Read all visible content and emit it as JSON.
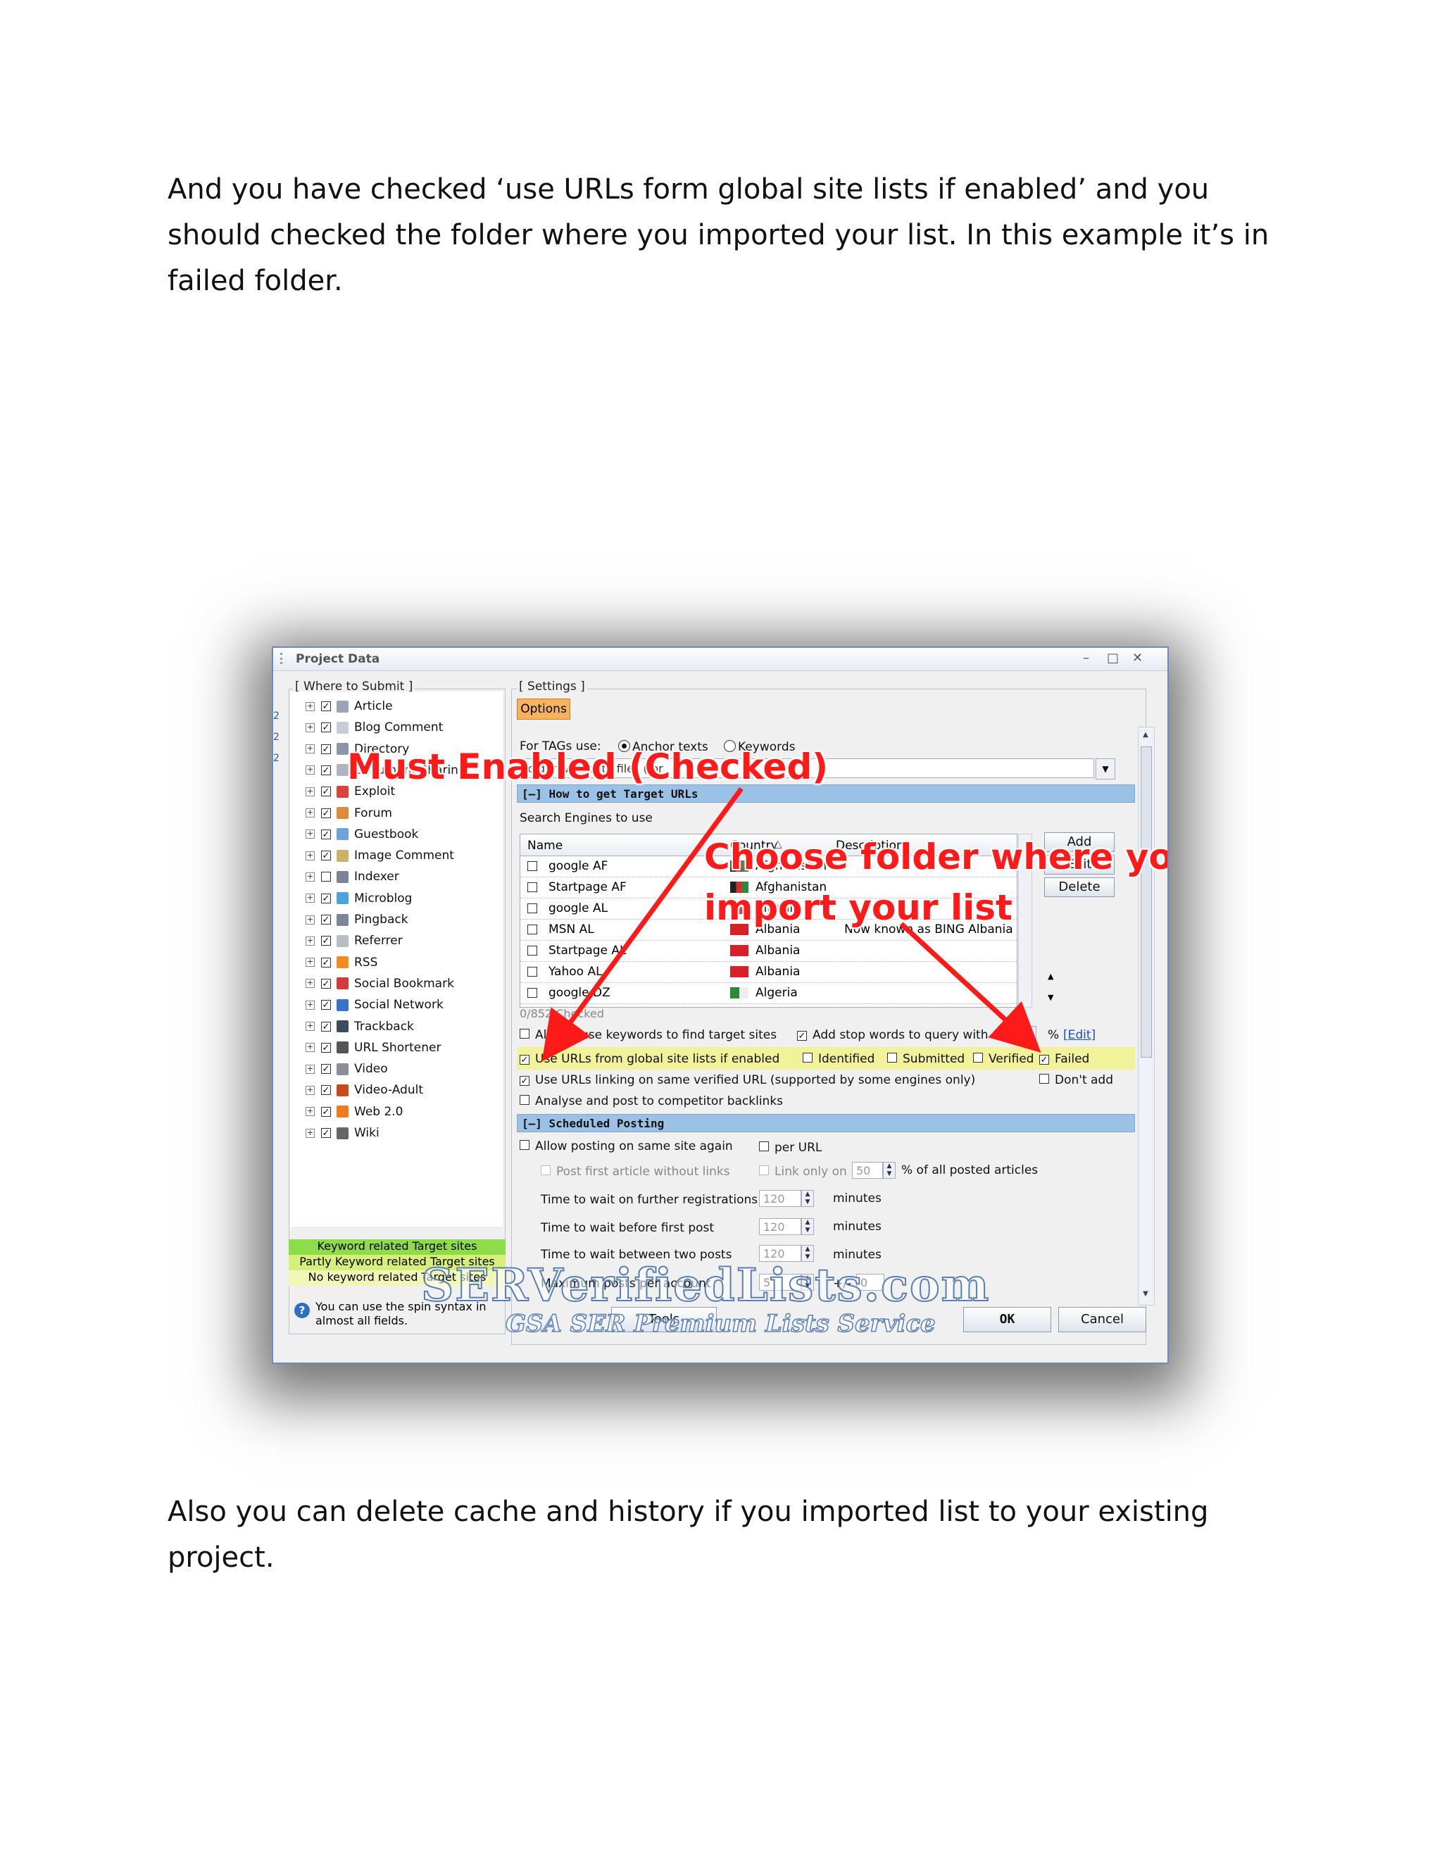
{
  "document": {
    "paragraph_1": "And you have checked ‘use URLs form global site lists if enabled’  and you should checked the folder where you imported your list. In this example it’s in failed folder.",
    "paragraph_2": "Also you can delete cache and history if you imported list to your existing project."
  },
  "window": {
    "title": "Project Data",
    "minimize": "–",
    "maximize": "□",
    "close": "✕"
  },
  "where_to_submit": {
    "legend": "[ Where to Submit ]",
    "items": [
      {
        "label": "Article",
        "checked": true,
        "icon": "article-icon",
        "color": "#9aa6b8"
      },
      {
        "label": "Blog Comment",
        "checked": true,
        "icon": "comment-icon",
        "color": "#c8ccd6"
      },
      {
        "label": "Directory",
        "checked": true,
        "icon": "directory-icon",
        "color": "#8c96aa"
      },
      {
        "label": "Document Sharing",
        "checked": true,
        "icon": "document-icon",
        "color": "#b0b4c0"
      },
      {
        "label": "Exploit",
        "checked": true,
        "icon": "exploit-icon",
        "color": "#d9443a"
      },
      {
        "label": "Forum",
        "checked": true,
        "icon": "forum-icon",
        "color": "#e08a3c"
      },
      {
        "label": "Guestbook",
        "checked": true,
        "icon": "guestbook-icon",
        "color": "#6fa4d8"
      },
      {
        "label": "Image Comment",
        "checked": true,
        "icon": "image-comment-icon",
        "color": "#c9b36a"
      },
      {
        "label": "Indexer",
        "checked": false,
        "icon": "indexer-icon",
        "color": "#7a8496"
      },
      {
        "label": "Microblog",
        "checked": true,
        "icon": "microblog-icon",
        "color": "#4aa3df"
      },
      {
        "label": "Pingback",
        "checked": true,
        "icon": "pingback-icon",
        "color": "#7b8799"
      },
      {
        "label": "Referrer",
        "checked": true,
        "icon": "referrer-icon",
        "color": "#b7bcc6"
      },
      {
        "label": "RSS",
        "checked": true,
        "icon": "rss-icon",
        "color": "#f28c1f"
      },
      {
        "label": "Social Bookmark",
        "checked": true,
        "icon": "social-bookmark-icon",
        "color": "#d63a3a"
      },
      {
        "label": "Social Network",
        "checked": true,
        "icon": "social-network-icon",
        "color": "#3a72c8"
      },
      {
        "label": "Trackback",
        "checked": true,
        "icon": "trackback-icon",
        "color": "#3e4c60"
      },
      {
        "label": "URL Shortener",
        "checked": true,
        "icon": "url-shortener-icon",
        "color": "#555"
      },
      {
        "label": "Video",
        "checked": true,
        "icon": "video-icon",
        "color": "#8a8f99"
      },
      {
        "label": "Video-Adult",
        "checked": true,
        "icon": "video-adult-icon",
        "color": "#c84a1c"
      },
      {
        "label": "Web 2.0",
        "checked": true,
        "icon": "web20-icon",
        "color": "#f07a20"
      },
      {
        "label": "Wiki",
        "checked": true,
        "icon": "wiki-icon",
        "color": "#666"
      }
    ],
    "legend_keyword_related": "Keyword related Target sites",
    "legend_partly_keyword": "Partly Keyword related Target sites",
    "legend_no_keyword": "No keyword related Target sites",
    "spin_hint": "You can use the spin syntax in almost all fields.",
    "colors": {
      "keyword_related": "#8fdc4a",
      "partly": "#d7ee7a",
      "none": "#f1f7b4"
    }
  },
  "settings": {
    "legend": "[ Settings ]",
    "options_button": "Options",
    "tags_use_label": "For TAGs use:",
    "tags_anchor": "Anchor texts",
    "tags_keywords": "Keywords",
    "tags_selected": "Anchor texts",
    "dropdown_value": "Folder with data files (for",
    "how_to_get_header": "[–] How to get Target URLs",
    "search_engines_label": "Search Engines to use",
    "grid": {
      "columns": [
        "Name",
        "Country",
        "Description"
      ],
      "rows": [
        {
          "name": "google AF",
          "country": "Afghanistan",
          "description": ""
        },
        {
          "name": "Startpage AF",
          "country": "Afghanistan",
          "description": ""
        },
        {
          "name": "google AL",
          "country": "Albania",
          "description": ""
        },
        {
          "name": "MSN AL",
          "country": "Albania",
          "description": "Now known as BING Albania"
        },
        {
          "name": "Startpage AL",
          "country": "Albania",
          "description": ""
        },
        {
          "name": "Yahoo AL",
          "country": "Albania",
          "description": ""
        },
        {
          "name": "google DZ",
          "country": "Algeria",
          "description": ""
        }
      ],
      "checked_count": "0/852 Checked"
    },
    "add_button": "Add",
    "edit_button": "Edit",
    "delete_button": "Delete",
    "always_use_keywords": "Always use keywords to find target sites",
    "add_stop_words": "Add stop words to query with",
    "percent": "%",
    "edit_link": "[Edit]",
    "use_global_lists": "Use URLs from global site lists if enabled",
    "identified": "Identified",
    "submitted": "Submitted",
    "verified": "Verified",
    "failed": "Failed",
    "use_same_verified": "Use URLs linking on same verified URL (supported by some engines only)",
    "dont_add": "Don't add",
    "analyse_competitor": "Analyse and post to competitor backlinks",
    "scheduled_header": "[–] Scheduled Posting",
    "allow_posting": "Allow posting on same site again",
    "per_url": "per URL",
    "post_first_article": "Post first article without links",
    "link_only_on": "Link only on",
    "link_only_value": "50",
    "percent_posted": "% of all posted articles",
    "wait_registrations": "Time to wait on further registrations",
    "wait_registrations_value": "120",
    "wait_first_post": "Time to wait before first post",
    "wait_first_post_value": "120",
    "wait_two_posts": "Time to wait between two posts",
    "wait_two_posts_value": "120",
    "minutes": "minutes",
    "max_posts": "Maximum posts per account",
    "max_posts_value": "5",
    "plus_minus": "+/-",
    "plus_minus_value": "0",
    "tools_button": "Tools",
    "ok_button": "OK",
    "cancel_button": "Cancel",
    "highlight_color": "#f2f29a"
  },
  "annotations": {
    "must_enabled": "Must Enabled (Checked)",
    "choose_folder_line1": "Choose folder where you",
    "choose_folder_line2": "import your list",
    "color": "#ff1a1a"
  },
  "watermark": {
    "main": "SERVerifiedLists.com",
    "sub": "GSA SER Premium Lists Service"
  }
}
